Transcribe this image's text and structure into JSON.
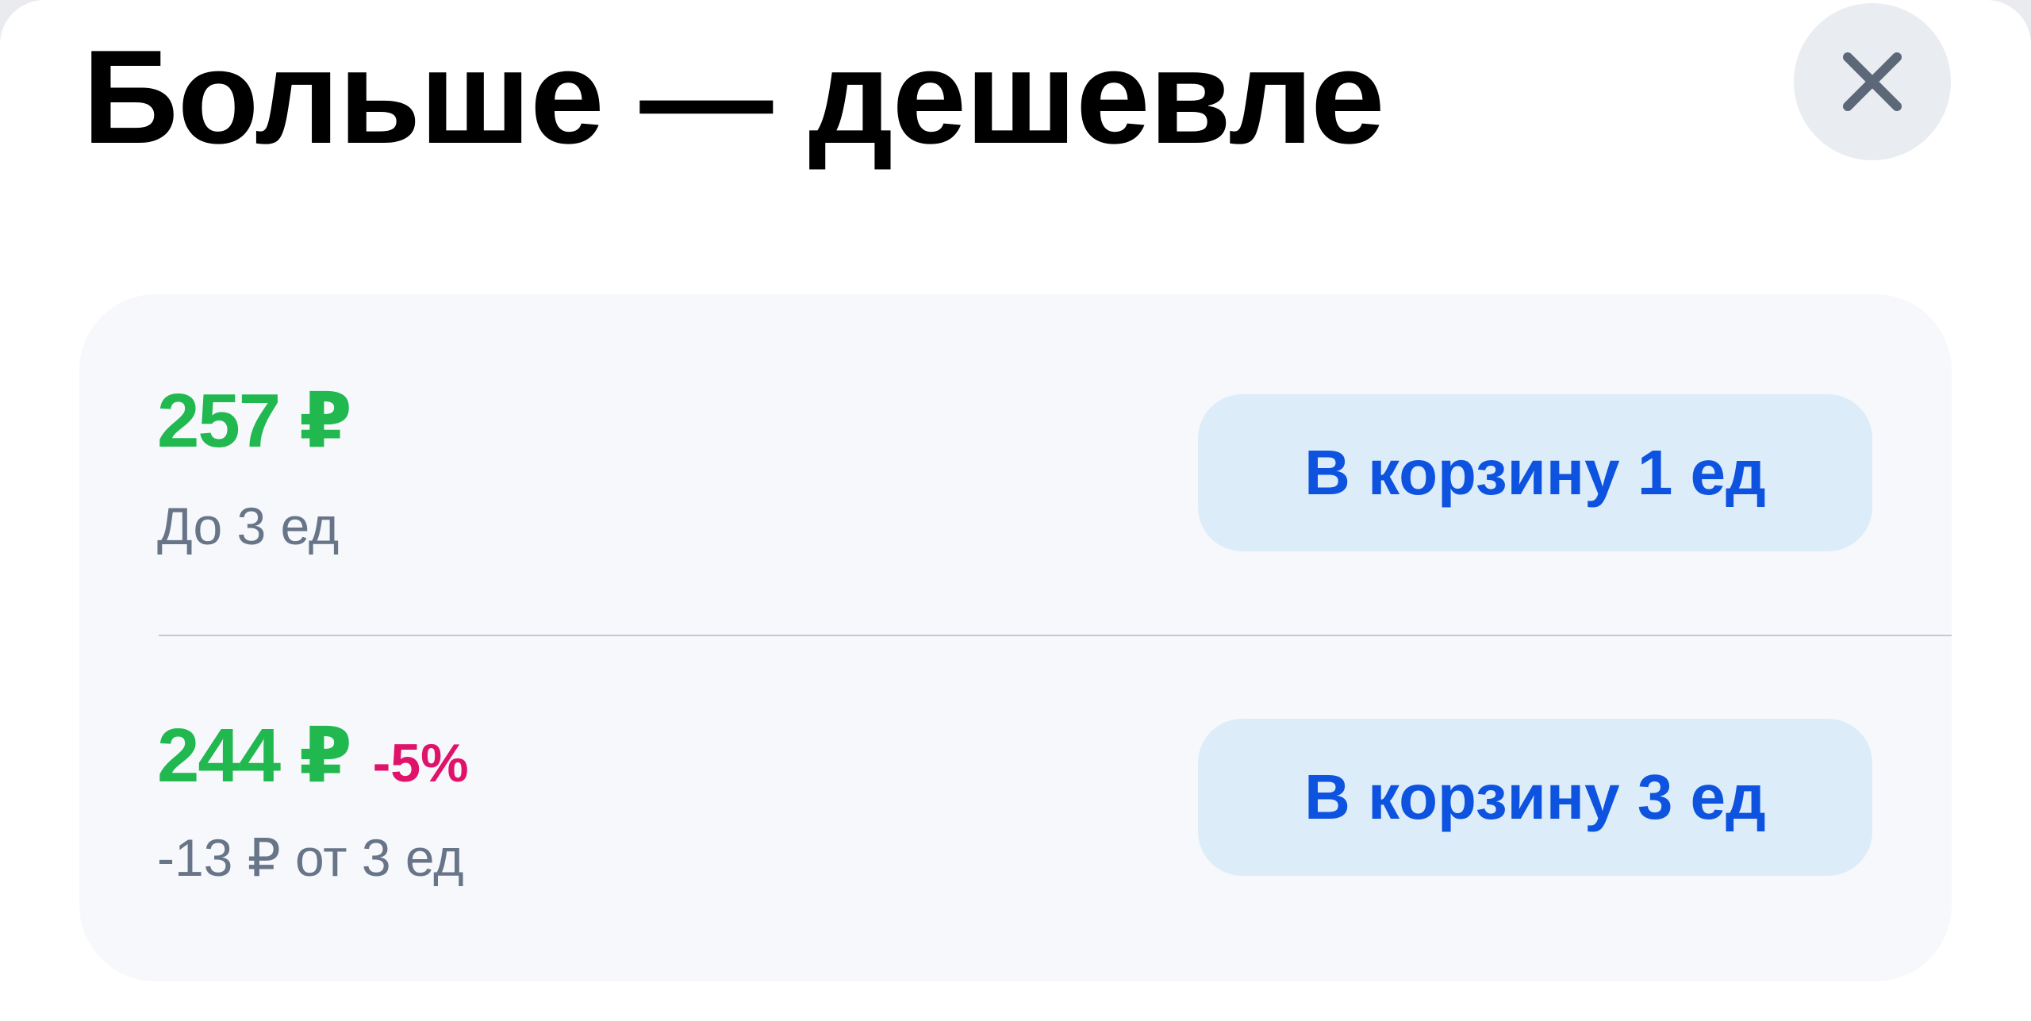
{
  "dialog": {
    "title": "Больше — дешевле",
    "close_icon": "close-icon"
  },
  "tiers": [
    {
      "price": "257 ₽",
      "discount": "",
      "subtext": "До 3 ед",
      "button_label": "В корзину 1 ед"
    },
    {
      "price": "244 ₽",
      "discount": "-5%",
      "subtext": "-13 ₽ от 3 ед",
      "button_label": "В корзину 3 ед"
    }
  ],
  "colors": {
    "price": "#20b84f",
    "discount": "#e0136b",
    "button_text": "#0d53e0",
    "button_bg": "#dcecf8",
    "subtext": "#687588",
    "card_bg": "#f6f8fb"
  }
}
